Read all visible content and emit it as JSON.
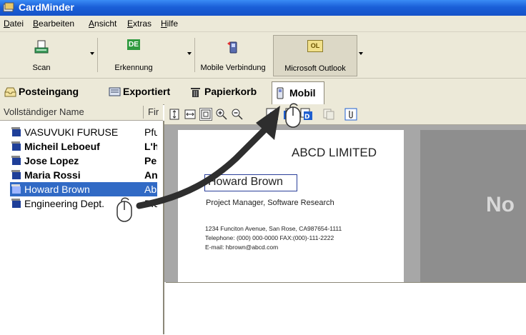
{
  "window": {
    "title": "CardMinder"
  },
  "menu": [
    "Datei",
    "Bearbeiten",
    "Ansicht",
    "Extras",
    "Hilfe"
  ],
  "toolbar": {
    "scan": "Scan",
    "recognition": "Erkennung",
    "recognition_badge": "DE",
    "mobile": "Mobile Verbindung",
    "outlook": "Microsoft Outlook",
    "outlook_badge": "OL"
  },
  "tabs": [
    "Posteingang",
    "Exportiert",
    "Papierkorb",
    "Mobil"
  ],
  "list": {
    "columns": [
      "Vollständiger Name",
      "Fir"
    ],
    "rows": [
      {
        "name": "VASUVUKI FURUSE",
        "firm": "Pfu",
        "bold": false,
        "selected": false
      },
      {
        "name": "Micheil Leboeuf",
        "firm": "L'h",
        "bold": true,
        "selected": false
      },
      {
        "name": "Jose Lopez",
        "firm": "Pe",
        "bold": true,
        "selected": false
      },
      {
        "name": "Maria Rossi",
        "firm": "An",
        "bold": true,
        "selected": false
      },
      {
        "name": "Howard Brown",
        "firm": "Ab",
        "bold": false,
        "selected": true
      },
      {
        "name": "Engineering Dept.",
        "firm": "Pfu",
        "bold": false,
        "selected": false
      }
    ]
  },
  "card": {
    "company": "ABCD LIMITED",
    "name": "Howard Brown",
    "title": "Project Manager, Software Research",
    "address": "1234 Funciton Avenue, San Rose, CA987654-1111",
    "phone": "Telephone: (000) 000-0000  FAX:(000)-111-2222",
    "email": "E-mail: hbrown@abcd.com"
  },
  "back_side_text": "No",
  "colors": {
    "titlebar": "#1a5fd8",
    "selection": "#316ac5",
    "toolbar": "#ece9d8",
    "preview_gray": "#a7a7a7"
  }
}
